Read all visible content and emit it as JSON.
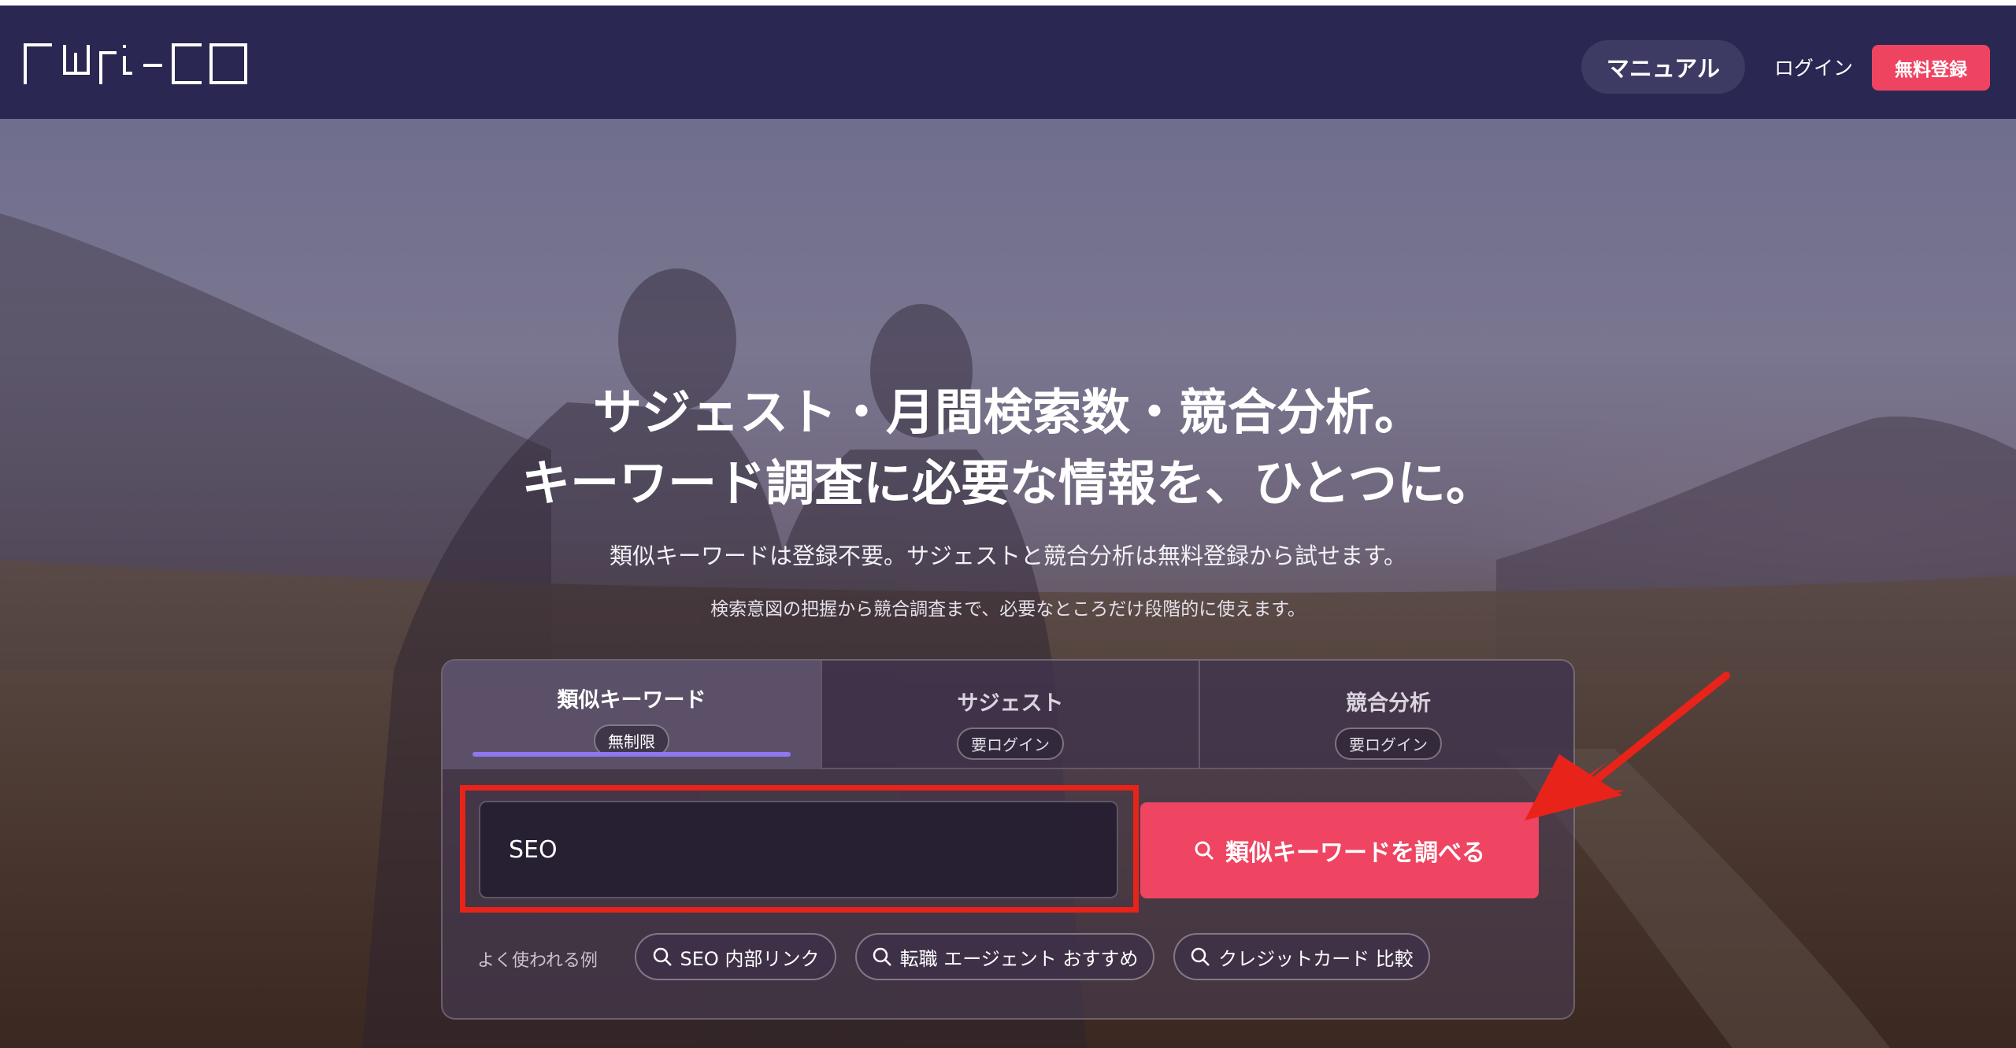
{
  "header": {
    "logo_text": "rwi-co",
    "nav": {
      "manual_label": "マニュアル",
      "login_label": "ログイン",
      "register_label": "無料登録"
    }
  },
  "hero": {
    "title_line1": "サジェスト・月間検索数・競合分析。",
    "title_line2": "キーワード調査に必要な情報を、ひとつに。",
    "subtitle1": "類似キーワードは登録不要。サジェストと競合分析は無料登録から試せます。",
    "subtitle2": "検索意図の把握から競合調査まで、必要なところだけ段階的に使えます。"
  },
  "search": {
    "tabs": [
      {
        "label": "類似キーワード",
        "badge": "無制限",
        "active": true
      },
      {
        "label": "サジェスト",
        "badge": "要ログイン",
        "active": false
      },
      {
        "label": "競合分析",
        "badge": "要ログイン",
        "active": false
      }
    ],
    "input_value": "SEO",
    "button_label": "類似キーワードを調べる",
    "examples_label": "よく使われる例",
    "examples": [
      "SEO 内部リンク",
      "転職 エージェント おすすめ",
      "クレジットカード 比較"
    ]
  },
  "colors": {
    "header_bg": "#2a2752",
    "accent": "#ef4462",
    "tab_underline": "#8e78f0",
    "annotation_red": "#e8231a"
  },
  "icons": [
    "search-icon",
    "arrow-annotation"
  ]
}
